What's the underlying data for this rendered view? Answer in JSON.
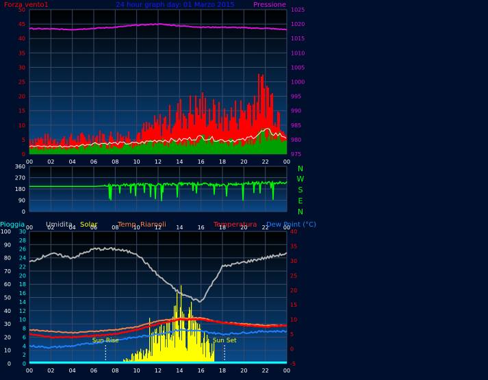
{
  "header": {
    "title": "24 hour graph day: 01 Marzo 2015",
    "left_label": "Forza vento1",
    "right_label": "Pressione"
  },
  "colors": {
    "background": "#00102c",
    "panel_top": "#000000",
    "panel_bottom": "#0a4a8a",
    "grid": "#3a4a68",
    "wind_gust": "#ff0000",
    "wind_avg": "#00a000",
    "wind_line": "#ffffff",
    "pressure": "#e010e0",
    "direction": "#00ff00",
    "humidity": "#b4b4b4",
    "solar": "#ffff00",
    "temp_inside": "#ff8040",
    "temperature": "#ff0000",
    "dew_point": "#2080ff",
    "rain": "#00ffff"
  },
  "x_ticks": [
    "00",
    "02",
    "04",
    "06",
    "08",
    "10",
    "12",
    "14",
    "16",
    "18",
    "20",
    "22",
    "00"
  ],
  "compass": [
    "N",
    "W",
    "S",
    "E",
    "N"
  ],
  "legend": {
    "rain": "Pioggia",
    "humidity": "Umidita",
    "solar": "Solar",
    "temp_inside": "Temp. Riarnoli",
    "temperature": "Temperatura",
    "dew_point": "Dew Point (°C)"
  },
  "annotations": {
    "sunrise": "Sun Rise",
    "sunset": "Sun Set"
  },
  "chart_data": [
    {
      "type": "line",
      "title": "24 hour graph day: 01 Marzo 2015",
      "x": [
        0,
        2,
        4,
        6,
        8,
        10,
        12,
        14,
        16,
        18,
        20,
        22,
        24
      ],
      "y_left": {
        "label": "Forza vento1",
        "range": [
          0,
          50
        ],
        "ticks": [
          0,
          5,
          10,
          15,
          20,
          25,
          30,
          35,
          40,
          45,
          50
        ]
      },
      "y_right": {
        "label": "Pressione",
        "range": [
          975,
          1025
        ],
        "ticks": [
          975,
          980,
          985,
          990,
          995,
          1000,
          1005,
          1010,
          1015,
          1020,
          1025
        ]
      },
      "series": [
        {
          "name": "Pressione",
          "axis": "right",
          "values": [
            1018.4,
            1018.3,
            1018.1,
            1018.5,
            1018.9,
            1019.6,
            1020.0,
            1019.4,
            1018.9,
            1018.9,
            1018.7,
            1018.5,
            1018.1
          ]
        },
        {
          "name": "Gust",
          "axis": "left",
          "values": [
            5,
            5,
            5,
            6,
            6,
            7,
            10,
            14,
            16,
            12,
            15,
            22,
            9
          ]
        },
        {
          "name": "Wind",
          "axis": "left",
          "values": [
            2,
            2,
            2,
            3,
            3,
            3,
            4,
            4,
            5,
            4,
            4,
            7,
            5
          ]
        }
      ],
      "grid": true
    },
    {
      "type": "scatter",
      "x": [
        0,
        2,
        4,
        6,
        8,
        10,
        12,
        14,
        16,
        18,
        20,
        22,
        24
      ],
      "y": {
        "range": [
          0,
          360
        ],
        "ticks": [
          0,
          90,
          180,
          270,
          360
        ]
      },
      "series": [
        {
          "name": "direction",
          "values": [
            200,
            200,
            200,
            200,
            210,
            215,
            215,
            220,
            220,
            210,
            225,
            230,
            230
          ]
        }
      ],
      "grid": true
    },
    {
      "type": "line",
      "x": [
        0,
        2,
        4,
        6,
        8,
        10,
        12,
        14,
        16,
        18,
        20,
        22,
        24
      ],
      "y_left_rain": {
        "label": "Pioggia",
        "range": [
          0,
          100
        ],
        "ticks": [
          0,
          10,
          20,
          30,
          40,
          50,
          60,
          70,
          80,
          90,
          100
        ]
      },
      "y_left_humidity": {
        "label": "Umidita",
        "range": [
          0,
          30
        ],
        "ticks": [
          0,
          2,
          4,
          6,
          8,
          10,
          12,
          14,
          16,
          18,
          20,
          22,
          24,
          26,
          28,
          30
        ]
      },
      "y_right": {
        "label": "Dew Point (°C)",
        "range": [
          -5,
          40
        ],
        "ticks": [
          -5,
          0,
          5,
          10,
          15,
          20,
          25,
          30,
          35,
          40
        ]
      },
      "series": [
        {
          "name": "Umidita",
          "axis": "left_humidity",
          "values": [
            23,
            25,
            24,
            26,
            26,
            25,
            20,
            16,
            14,
            22,
            23,
            24,
            25
          ]
        },
        {
          "name": "Temperatura",
          "axis": "right",
          "values": [
            5,
            4,
            4,
            4.5,
            5,
            6.5,
            8.5,
            10,
            10,
            9,
            8,
            7.5,
            8
          ]
        },
        {
          "name": "Temp. Riarnoli",
          "axis": "right",
          "values": [
            6.5,
            6,
            5.5,
            6,
            6.5,
            7.5,
            9.5,
            10.5,
            10.5,
            9,
            8.5,
            8,
            8
          ]
        },
        {
          "name": "Dew Point (°C)",
          "axis": "right",
          "values": [
            1,
            0.5,
            1,
            2,
            3,
            4,
            5,
            6.5,
            6,
            5,
            5.5,
            6,
            6
          ]
        },
        {
          "name": "Solar",
          "axis": "left_humidity",
          "values": [
            0,
            0,
            0,
            0,
            0,
            2,
            6,
            10,
            6,
            0,
            0,
            0,
            0
          ]
        },
        {
          "name": "Pioggia",
          "axis": "left_rain",
          "values": [
            0,
            0,
            0,
            0,
            0,
            0,
            0,
            0,
            0,
            0,
            0,
            0,
            0
          ]
        }
      ],
      "sunrise": 7.1,
      "sunset": 18.2,
      "grid": true
    }
  ]
}
